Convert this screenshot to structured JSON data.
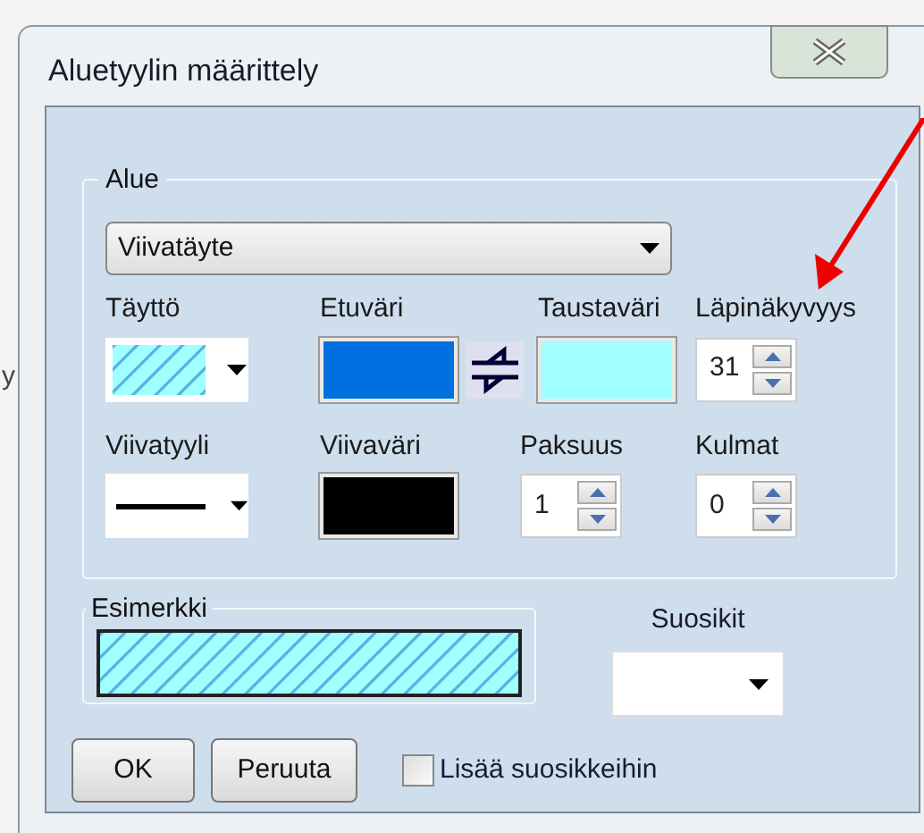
{
  "background_text": "y",
  "window": {
    "title": "Aluetyylin määrittely"
  },
  "area": {
    "legend": "Alue",
    "fill_type": "Viivatäyte",
    "rows": [
      [
        {
          "kind": "pattern",
          "label": "Täyttö"
        },
        {
          "kind": "color",
          "label": "Etuväri",
          "color": "#0070e0",
          "swap_button": true
        },
        {
          "kind": "color",
          "label": "Taustaväri",
          "color": "#a0ffff"
        },
        {
          "kind": "spinner",
          "label": "Läpinäkyvyys",
          "value": "31"
        }
      ],
      [
        {
          "kind": "line",
          "label": "Viivatyyli"
        },
        {
          "kind": "color",
          "label": "Viivaväri",
          "color": "#000000"
        },
        {
          "kind": "spinner",
          "label": "Paksuus",
          "value": "1"
        },
        {
          "kind": "spinner",
          "label": "Kulmat",
          "value": "0"
        }
      ]
    ]
  },
  "example": {
    "legend": "Esimerkki"
  },
  "favorites": {
    "label": "Suosikit"
  },
  "buttons": [
    "OK",
    "Peruuta"
  ],
  "add_to_favorites": {
    "label": "Lisää suosikkeihin",
    "checked": false
  }
}
